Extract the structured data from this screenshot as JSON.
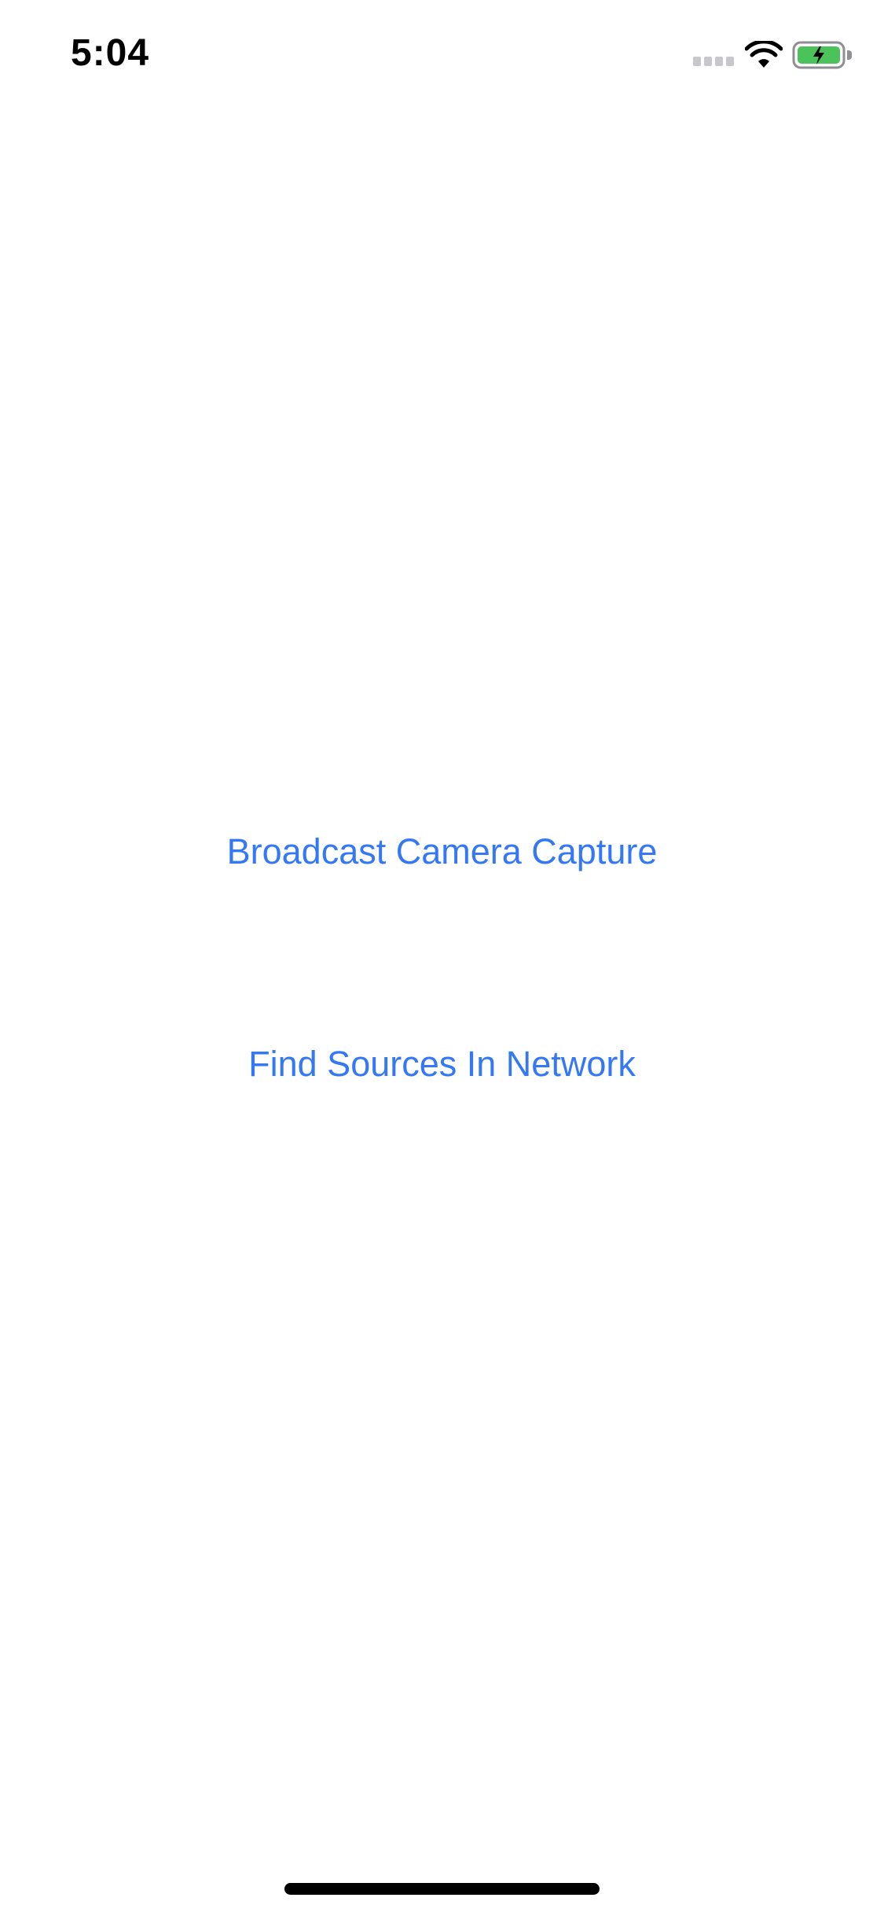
{
  "status_bar": {
    "time": "5:04",
    "icons": {
      "signal": "cellular-signal-icon",
      "wifi": "wifi-icon",
      "battery": "battery-charging-icon"
    },
    "colors": {
      "battery_fill": "#4cc35a",
      "inactive_signal": "#c7c7cc"
    }
  },
  "main": {
    "broadcast_label": "Broadcast Camera Capture",
    "find_sources_label": "Find Sources In Network"
  },
  "theme": {
    "accent": "#3478f6",
    "background": "#ffffff",
    "text": "#000000"
  }
}
